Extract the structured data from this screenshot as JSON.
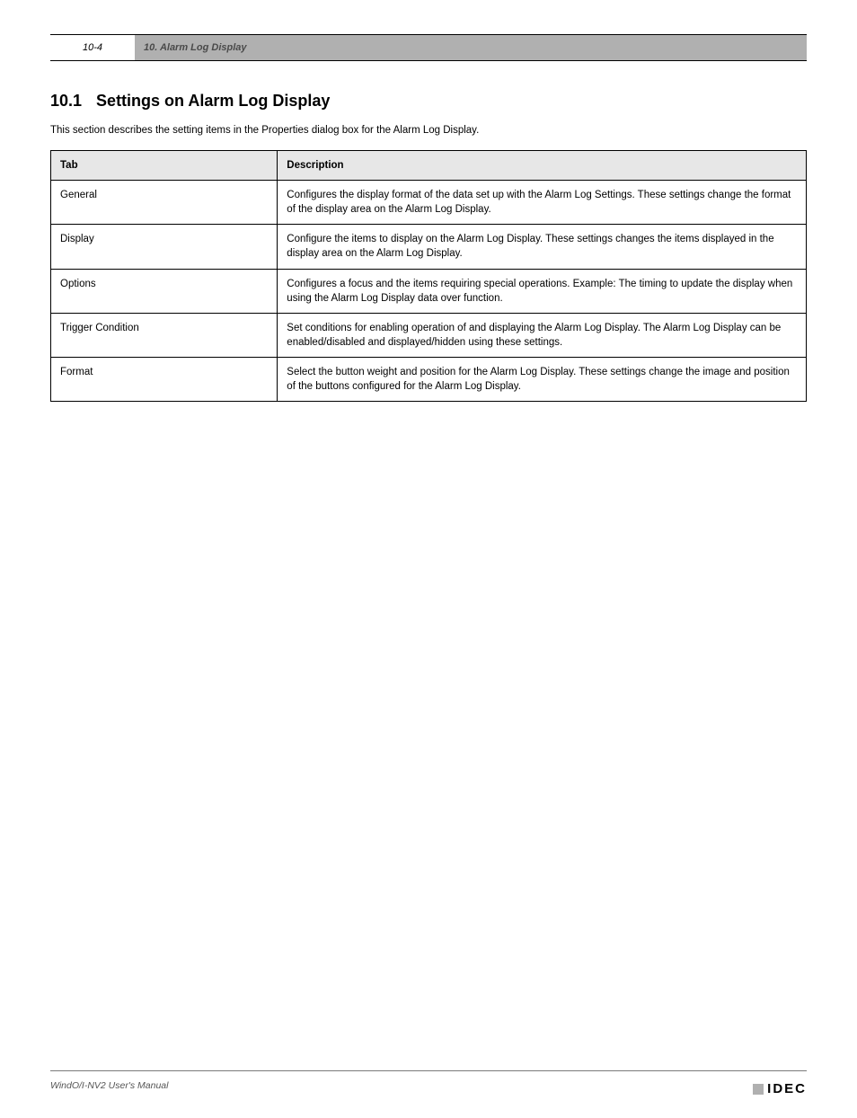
{
  "header": {
    "page_number": "10-4",
    "running_title": "10. Alarm Log Display"
  },
  "section": {
    "number": "10.1",
    "title": "Settings on Alarm Log Display"
  },
  "intro": "This section describes the setting items in the Properties dialog box for the Alarm Log Display.",
  "table": {
    "headers": [
      "Tab",
      "Description"
    ],
    "rows": [
      {
        "tab": "General",
        "desc": "Configures the display format of the data set up with the Alarm Log Settings. These settings change the format of the display area on the Alarm Log Display."
      },
      {
        "tab": "Display",
        "desc": "Configure the items to display on the Alarm Log Display. These settings changes the items displayed in the display area on the Alarm Log Display."
      },
      {
        "tab": "Options",
        "desc": "Configures a focus and the items requiring special operations. Example: The timing to update the display when using the Alarm Log Display data over function."
      },
      {
        "tab": "Trigger Condition",
        "desc": "Set conditions for enabling operation of and displaying the Alarm Log Display. The Alarm Log Display can be enabled/disabled and displayed/hidden using these settings."
      },
      {
        "tab": "Format",
        "desc": "Select the button weight and position for the Alarm Log Display. These settings change the image and position of the buttons configured for the Alarm Log Display."
      }
    ]
  },
  "footer": {
    "text": "WindO/I-NV2 User's Manual",
    "logo": "IDEC"
  }
}
